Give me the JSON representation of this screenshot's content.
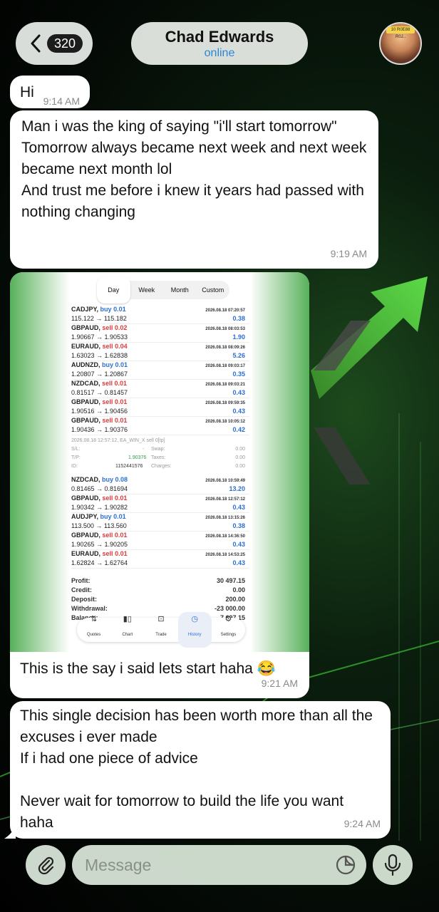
{
  "header": {
    "back_count": "320",
    "contact_name": "Chad Edwards",
    "contact_status": "online",
    "avatar_sign_text": "10 R0E88 R0J.."
  },
  "messages": [
    {
      "text": "Hi",
      "time": "9:14 AM"
    },
    {
      "lines": [
        "Man i was the king of saying \"i'll start tomorrow\"",
        "",
        "Tomorrow always became next week and next week became next month lol",
        "",
        "And trust me before i knew it years had passed with nothing changing"
      ],
      "time": "9:19 AM"
    },
    {
      "caption": "This is the say i said lets start haha 😂",
      "time": "9:21 AM"
    },
    {
      "lines": [
        "This single decision has been worth more than all the excuses i ever made",
        "If i had one piece of advice",
        "",
        "Never wait for tomorrow to build the life you want haha"
      ],
      "time": "9:24 AM"
    }
  ],
  "screenshot": {
    "tabs": [
      "Day",
      "Week",
      "Month",
      "Custom"
    ],
    "active_tab": "Day",
    "trades": [
      {
        "symbol": "CADJPY,",
        "side": "buy",
        "lot": "0.01",
        "prices": "115.122 → 115.182",
        "datetime": "2026.08.18 07:20:57",
        "profit": "0.38"
      },
      {
        "symbol": "GBPAUD,",
        "side": "sell",
        "lot": "0.02",
        "prices": "1.90667 → 1.90533",
        "datetime": "2026.08.18 08:03:53",
        "profit": "1.90"
      },
      {
        "symbol": "EURAUD,",
        "side": "sell",
        "lot": "0.04",
        "prices": "1.63023 → 1.62838",
        "datetime": "2026.08.18 08:09:26",
        "profit": "5.26"
      },
      {
        "symbol": "AUDNZD,",
        "side": "buy",
        "lot": "0.01",
        "prices": "1.20807 → 1.20867",
        "datetime": "2026.08.18 09:03:17",
        "profit": "0.35"
      },
      {
        "symbol": "NZDCAD,",
        "side": "sell",
        "lot": "0.01",
        "prices": "0.81517 → 0.81457",
        "datetime": "2026.08.18 09:03:21",
        "profit": "0.43"
      },
      {
        "symbol": "GBPAUD,",
        "side": "sell",
        "lot": "0.01",
        "prices": "1.90516 → 1.90456",
        "datetime": "2026.08.18 09:59:35",
        "profit": "0.43"
      },
      {
        "symbol": "GBPAUD,",
        "side": "sell",
        "lot": "0.01",
        "prices": "1.90436 → 1.90376",
        "datetime": "2026.08.18 10:05:12",
        "profit": "0.42"
      }
    ],
    "detail": {
      "header": "2026.08.18 12:57:12, EA_WIN_X sell 0[tp]",
      "sl_label": "S/L:",
      "sl_value": "-",
      "swap_label": "Swap:",
      "swap_value": "0.00",
      "tp_label": "T/P:",
      "tp_value": "1.90376",
      "taxes_label": "Taxes:",
      "taxes_value": "0.00",
      "id_label": "ID:",
      "id_value": "1152441576",
      "charges_label": "Charges:",
      "charges_value": "0.00"
    },
    "trades2": [
      {
        "symbol": "NZDCAD,",
        "side": "buy",
        "lot": "0.08",
        "prices": "0.81465 → 0.81694",
        "datetime": "2026.08.18 10:59:49",
        "profit": "13.20"
      },
      {
        "symbol": "GBPAUD,",
        "side": "sell",
        "lot": "0.01",
        "prices": "1.90342 → 1.90282",
        "datetime": "2026.08.18 12:57:12",
        "profit": "0.43"
      },
      {
        "symbol": "AUDJPY,",
        "side": "buy",
        "lot": "0.01",
        "prices": "113.500 → 113.560",
        "datetime": "2026.08.18 13:15:26",
        "profit": "0.38"
      },
      {
        "symbol": "GBPAUD,",
        "side": "sell",
        "lot": "0.01",
        "prices": "1.90265 → 1.90205",
        "datetime": "2026.08.18 14:36:50",
        "profit": "0.43"
      },
      {
        "symbol": "EURAUD,",
        "side": "sell",
        "lot": "0.01",
        "prices": "1.62824 → 1.62764",
        "datetime": "2026.08.18 14:53:25",
        "profit": "0.43"
      }
    ],
    "summary": [
      {
        "label": "Profit:",
        "value": "30 497.15"
      },
      {
        "label": "Credit:",
        "value": "0.00"
      },
      {
        "label": "Deposit:",
        "value": "200.00"
      },
      {
        "label": "Withdrawal:",
        "value": "-23 000.00"
      },
      {
        "label": "Balance:",
        "value": "7 697.15"
      }
    ],
    "nav": [
      "Quotes",
      "Chart",
      "Trade",
      "History",
      "Settings"
    ],
    "active_nav": "History"
  },
  "composer": {
    "placeholder": "Message"
  },
  "colors": {
    "link_blue": "#2a86d8",
    "buy_blue": "#2b6fd6",
    "sell_red": "#e0393a",
    "bubble_white": "#ffffff",
    "accent_green": "#3fae3f"
  },
  "icons": {
    "back": "chevron-left-icon",
    "attach": "paperclip-icon",
    "sticker": "sticker-icon",
    "mic": "microphone-icon"
  }
}
